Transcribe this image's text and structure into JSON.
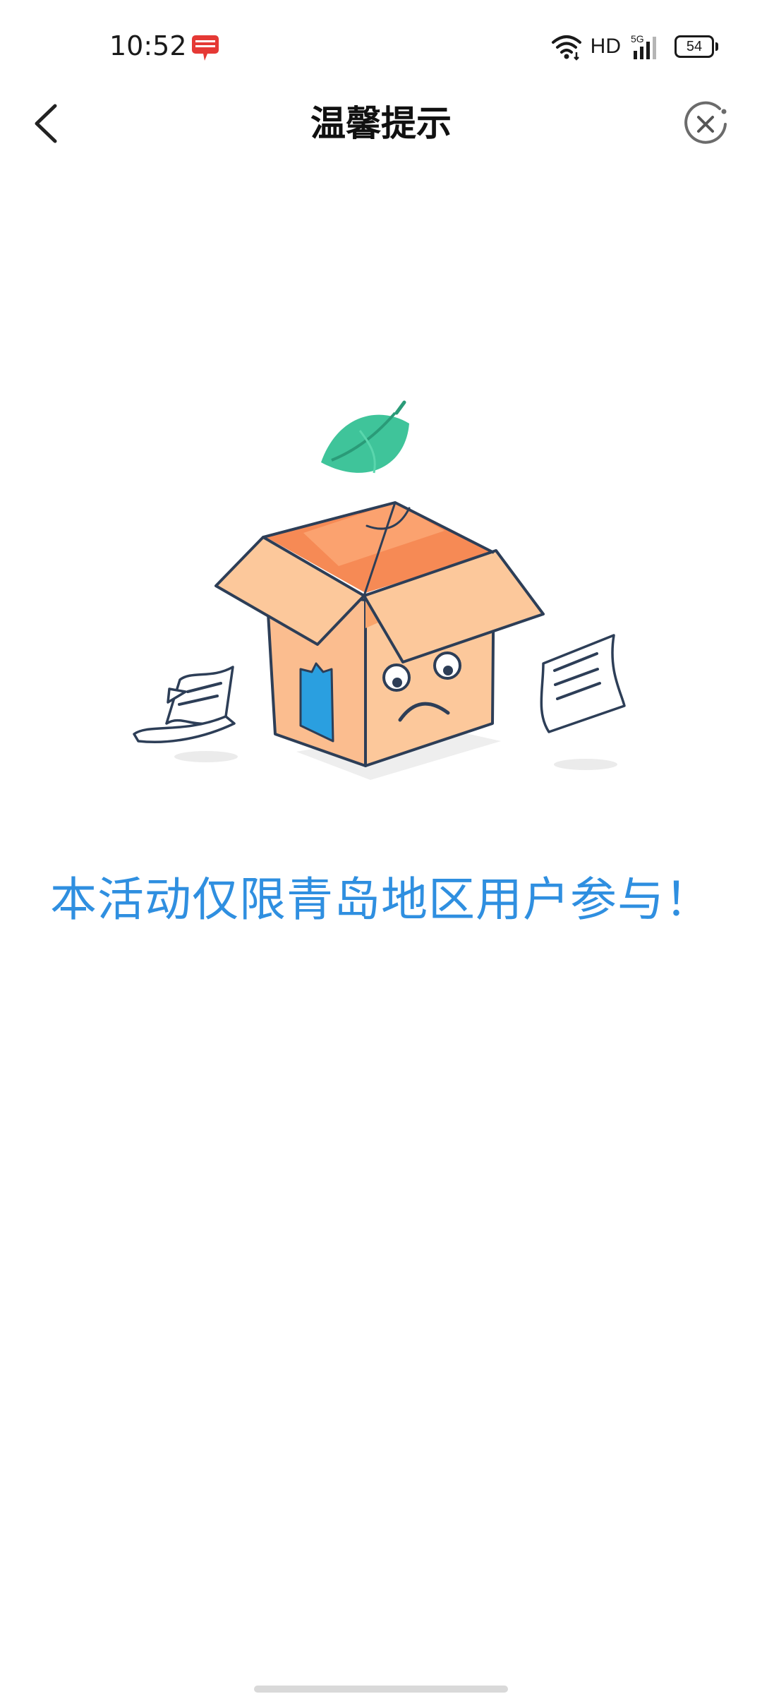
{
  "status_bar": {
    "time": "10:52",
    "network_label": "HD",
    "network_gen": "5G",
    "battery": "54",
    "icons": [
      "app-notification-icon",
      "wifi-icon",
      "signal-icon",
      "battery-icon"
    ]
  },
  "nav": {
    "title": "温馨提示",
    "back_icon": "back-arrow-icon",
    "close_icon": "close-circle-icon"
  },
  "illustration": {
    "icon": "empty-box-sad-face-illustration"
  },
  "notice": {
    "text": "本活动仅限青岛地区用户参与！"
  },
  "colors": {
    "accent_text": "#2f8fe0",
    "box_orange": "#f9a46b",
    "box_light": "#fcc89b",
    "leaf_green": "#3fc49a",
    "outline": "#2d3e57"
  }
}
